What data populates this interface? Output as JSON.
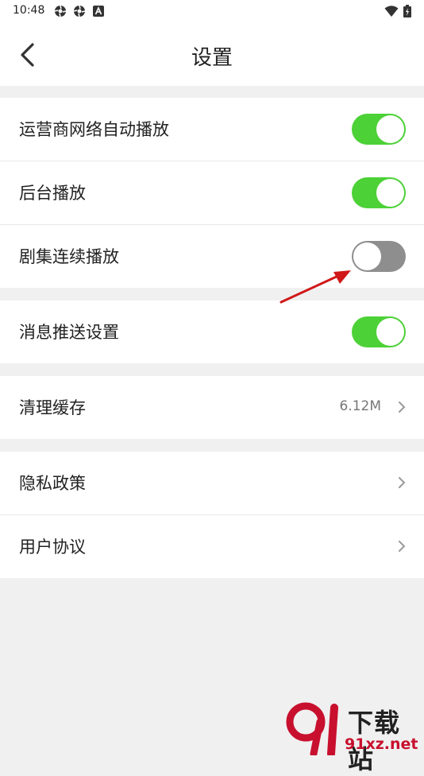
{
  "status_bar": {
    "time": "10:48",
    "left_icons": [
      "settings-gear-icon",
      "settings-gear-icon",
      "app-a-icon"
    ],
    "right_icons": [
      "wifi-icon",
      "battery-icon"
    ]
  },
  "header": {
    "title": "设置",
    "back_icon": "chevron-left-icon"
  },
  "settings_groups": [
    {
      "items": [
        {
          "label": "运营商网络自动播放",
          "toggle": true
        },
        {
          "label": "后台播放",
          "toggle": true
        },
        {
          "label": "剧集连续播放",
          "toggle": false
        }
      ]
    },
    {
      "items": [
        {
          "label": "消息推送设置",
          "toggle": true
        }
      ]
    },
    {
      "items": [
        {
          "label": "清理缓存",
          "value": "6.12M",
          "chevron": true
        }
      ]
    },
    {
      "items": [
        {
          "label": "隐私政策",
          "chevron": true
        },
        {
          "label": "用户协议",
          "chevron": true
        }
      ]
    }
  ],
  "watermark": {
    "text": "下载站",
    "url": "91xz.net"
  },
  "colors": {
    "toggle_on": "#4cd137",
    "toggle_off": "#8e8e8e",
    "page_background": "#f0f0f0",
    "annotation_arrow": "#d01818",
    "watermark_red": "#c8102e"
  }
}
